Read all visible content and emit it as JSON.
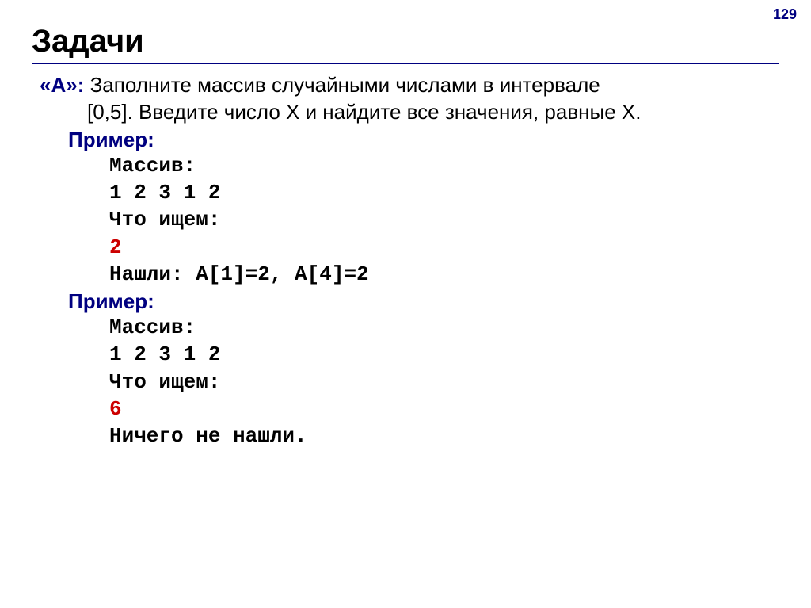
{
  "page_number": "129",
  "title": "Задачи",
  "task": {
    "label": "«A»:",
    "line1": " Заполните массив случайными числами в интервале",
    "line2": "[0,5]. Введите число X и найдите все значения, равные X."
  },
  "example1": {
    "label": "Пример:",
    "lines": {
      "l0": "Массив:",
      "l1": "1 2 3 1 2",
      "l2": "Что ищем:",
      "l3": "2",
      "l4": "Нашли: A[1]=2, A[4]=2"
    }
  },
  "example2": {
    "label": "Пример:",
    "lines": {
      "l0": "Массив:",
      "l1": "1 2 3 1 2",
      "l2": "Что ищем:",
      "l3": "6",
      "l4": "Ничего не нашли."
    }
  }
}
